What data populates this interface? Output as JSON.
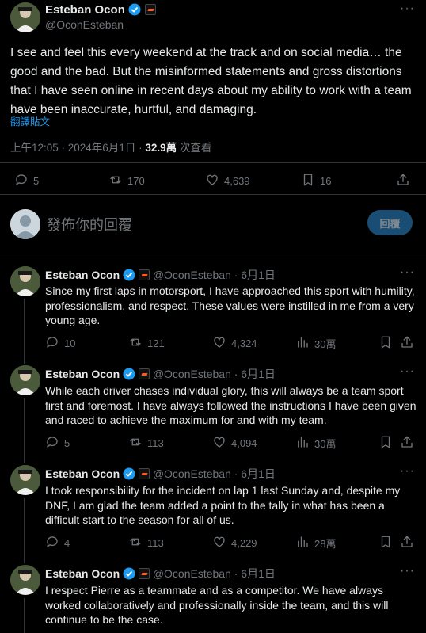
{
  "main_tweet": {
    "author_name": "Esteban Ocon",
    "handle": "@OconEsteban",
    "body": "I see and feel this every weekend at the track and on social media… the good and the bad. But the misinformed statements and gross distortions that I have seen online in recent days about my ability to work with a team have been inaccurate, hurtful, and damaging.",
    "translate_label": "翻譯貼文",
    "time": "上午12:05 · 2024年6月1日 · ",
    "views_count": "32.9萬",
    "views_label": " 次查看",
    "replies": "5",
    "retweets": "170",
    "likes": "4,639",
    "bookmarks": "16"
  },
  "composer": {
    "placeholder": "發佈你的回覆",
    "reply_button": "回覆"
  },
  "replies": [
    {
      "author_name": "Esteban Ocon",
      "handle": "@OconEsteban",
      "date": "· 6月1日",
      "body": "Since my first laps in motorsport, I have approached this sport with humility, professionalism, and respect. These values were instilled in me from a very young age.",
      "replies": "10",
      "retweets": "121",
      "likes": "4,324",
      "views": "30萬"
    },
    {
      "author_name": "Esteban Ocon",
      "handle": "@OconEsteban",
      "date": "· 6月1日",
      "body": "While each driver chases individual glory, this will always be a team sport first and foremost. I have always followed the instructions I have been given and raced to achieve the maximum for and with my team.",
      "replies": "5",
      "retweets": "113",
      "likes": "4,094",
      "views": "30萬"
    },
    {
      "author_name": "Esteban Ocon",
      "handle": "@OconEsteban",
      "date": "· 6月1日",
      "body": "I took responsibility for the incident on lap 1 last Sunday and, despite my DNF, I am glad the team added a point to the tally in what has been a difficult start to the season for all of us.",
      "replies": "4",
      "retweets": "113",
      "likes": "4,229",
      "views": "28萬"
    },
    {
      "author_name": "Esteban Ocon",
      "handle": "@OconEsteban",
      "date": "· 6月1日",
      "body": "I respect Pierre as a teammate and as a competitor. We have always worked collaboratively and professionally inside the team, and this will continue to be the case."
    }
  ],
  "colors": {
    "background": "#000000",
    "text": "#e7e9ea",
    "muted": "#71767b",
    "accent": "#1d9bf0",
    "divider": "#2f3336",
    "reply_button_bg": "#1a4d73"
  }
}
